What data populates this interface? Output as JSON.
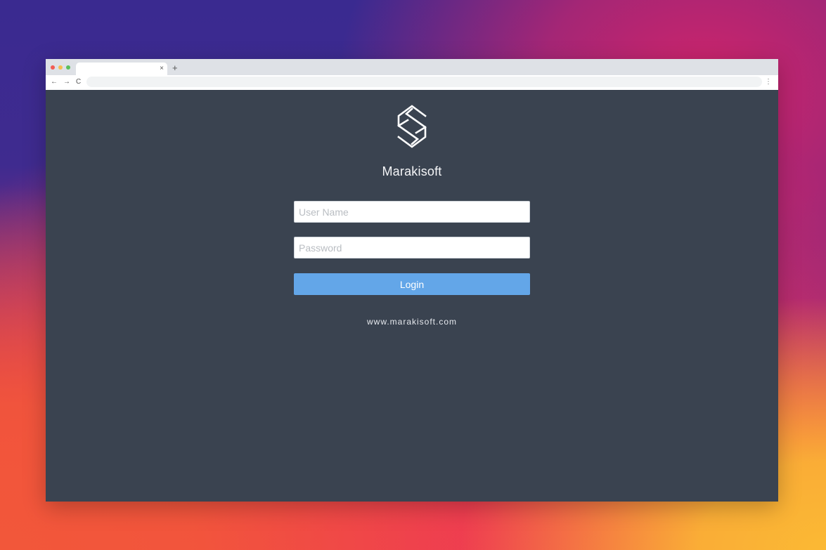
{
  "browser": {
    "tab_close_symbol": "×",
    "new_tab_symbol": "+",
    "back_symbol": "←",
    "forward_symbol": "→",
    "reload_symbol": "C",
    "menu_symbol": "⋮",
    "address": ""
  },
  "login": {
    "brand_name": "Marakisoft",
    "username_placeholder": "User Name",
    "password_placeholder": "Password",
    "login_label": "Login",
    "website": "www.marakisoft.com"
  },
  "colors": {
    "page_background": "#3a4350",
    "login_button": "#63a6e8",
    "traffic_red": "#f25c54",
    "traffic_yellow": "#f6be4f",
    "traffic_green": "#5ac05a"
  },
  "icons": {
    "logo": "marakisoft-logo-icon"
  }
}
